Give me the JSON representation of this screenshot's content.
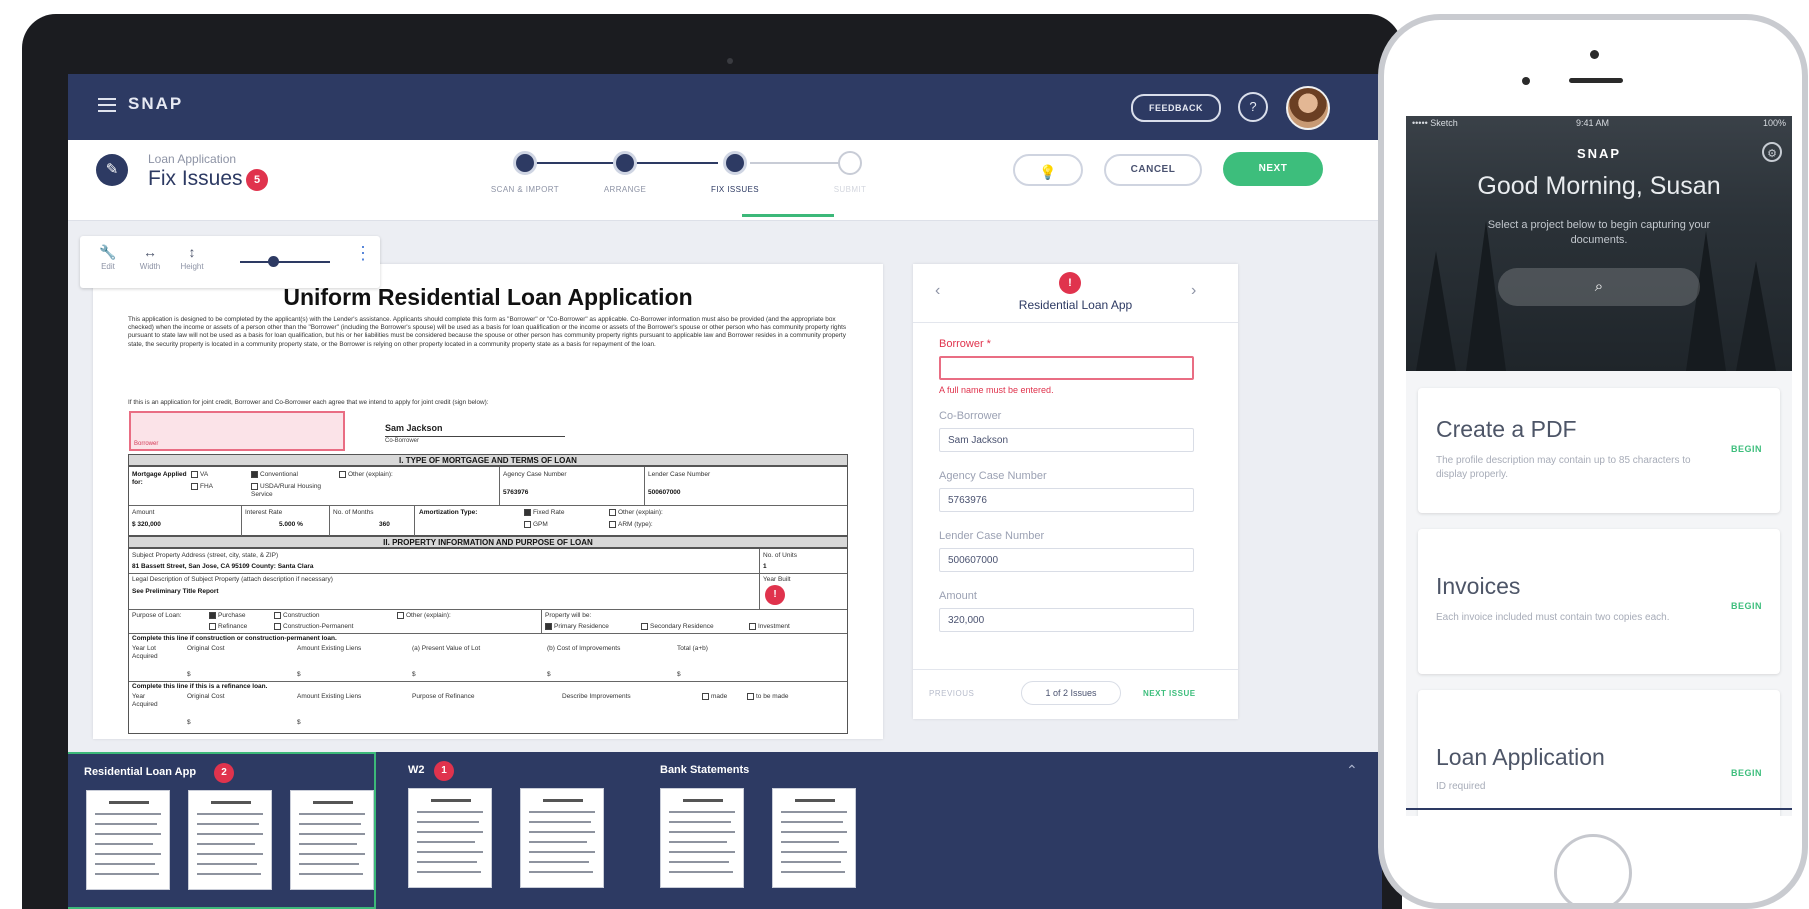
{
  "app": {
    "brand": "SNAP",
    "feedback_label": "FEEDBACK",
    "help_glyph": "?"
  },
  "header": {
    "kicker": "Loan Application",
    "title": "Fix Issues",
    "issue_badge": "5",
    "cancel_label": "CANCEL",
    "next_label": "NEXT"
  },
  "stepper": {
    "steps": [
      {
        "label": "SCAN & IMPORT",
        "state": "done"
      },
      {
        "label": "ARRANGE",
        "state": "done"
      },
      {
        "label": "FIX ISSUES",
        "state": "active"
      },
      {
        "label": "SUBMIT",
        "state": "future"
      }
    ]
  },
  "toolbar": {
    "tools": [
      {
        "icon": "wrench-icon",
        "glyph": "🔧",
        "label": "Edit"
      },
      {
        "icon": "width-icon",
        "glyph": "↔",
        "label": "Width"
      },
      {
        "icon": "height-icon",
        "glyph": "↕",
        "label": "Height"
      }
    ],
    "zoom_level": 0.3
  },
  "document": {
    "heading": "Uniform Residential Loan Application",
    "intro": "This application is designed to be completed by the applicant(s) with the Lender's assistance. Applicants should complete this form as \"Borrower\" or \"Co-Borrower\" as applicable. Co-Borrower information must also be provided (and the appropriate box checked) when the income or assets of a person other than the \"Borrower\" (including the Borrower's spouse) will be used as a basis for loan qualification or the income or assets of the Borrower's spouse or other person who has community property rights pursuant to state law will not be used as a basis for loan qualification, but his or her liabilities must be considered because the spouse or other person has community property rights pursuant to applicable law and Borrower resides in a community property state, the security property is located in a community property state, or the Borrower is relying on other property located in a community property state as a basis for repayment of the loan.",
    "joint_credit_line": "If this is an application for joint credit, Borrower and Co-Borrower each agree that we intend to apply for joint credit (sign below):",
    "borrower_caption": "Borrower",
    "coborrower_name": "Sam Jackson",
    "coborrower_caption": "Co-Borrower",
    "section1": "I. TYPE OF MORTGAGE AND TERMS OF LOAN",
    "section2": "II. PROPERTY INFORMATION AND PURPOSE OF LOAN",
    "mortgage_applied_for": "Mortgage Applied for:",
    "opt_va": "VA",
    "opt_fha": "FHA",
    "opt_conventional": "Conventional",
    "opt_usda": "USDA/Rural Housing Service",
    "opt_other": "Other (explain):",
    "agency_case_label": "Agency Case Number",
    "agency_case_value": "5763976",
    "lender_case_label": "Lender Case Number",
    "lender_case_value": "500607000",
    "amount_label": "Amount",
    "amount_value": "$ 320,000",
    "interest_label": "Interest Rate",
    "interest_value": "5.000 %",
    "months_label": "No. of Months",
    "months_value": "360",
    "amort_label": "Amortization Type:",
    "amort_fixed": "Fixed Rate",
    "amort_gpm": "GPM",
    "amort_other": "Other (explain):",
    "amort_arm": "ARM (type):",
    "subject_address_label": "Subject Property Address (street, city, state, & ZIP)",
    "subject_address_value": "81 Bassett Street, San Jose, CA 95109  County: Santa Clara",
    "units_label": "No. of Units",
    "units_value": "1",
    "legal_desc_label": "Legal Description of Subject Property (attach description if necessary)",
    "legal_desc_value": "See Preliminary Title Report",
    "year_built_label": "Year Built",
    "purpose_label": "Purpose of Loan:",
    "purpose_purchase": "Purchase",
    "purpose_refinance": "Refinance",
    "purpose_construction": "Construction",
    "purpose_construction_perm": "Construction-Permanent",
    "purpose_other": "Other (explain):",
    "property_will_be": "Property will be:",
    "prop_primary": "Primary Residence",
    "prop_secondary": "Secondary Residence",
    "prop_investment": "Investment",
    "construction_line": "Complete this line if construction or construction-permanent loan.",
    "col_year_lot": "Year Lot Acquired",
    "col_original_cost": "Original Cost",
    "col_existing_liens": "Amount Existing Liens",
    "col_present_value": "(a) Present Value of Lot",
    "col_improvements": "(b) Cost of Improvements",
    "col_total": "Total (a+b)",
    "dollar": "$",
    "refinance_line": "Complete this line if this is a refinance loan.",
    "col_year_acquired": "Year Acquired",
    "col_purpose_refi": "Purpose of Refinance",
    "col_describe_improvements": "Describe Improvements",
    "made": "made",
    "to_be_made": "to be made",
    "issue_marker": "!"
  },
  "issues_panel": {
    "badge": "!",
    "title": "Residential Loan App",
    "fields": [
      {
        "label": "Borrower *",
        "value": "",
        "error": true
      },
      {
        "label": "Co-Borrower",
        "value": "Sam Jackson",
        "error": false
      },
      {
        "label": "Agency Case Number",
        "value": "5763976",
        "error": false
      },
      {
        "label": "Lender Case Number",
        "value": "500607000",
        "error": false
      },
      {
        "label": "Amount",
        "value": "320,000",
        "error": false
      }
    ],
    "error_message": "A full name must be entered.",
    "previous_label": "PREVIOUS",
    "count_label": "1 of 2 Issues",
    "next_issue_label": "NEXT ISSUE"
  },
  "tray": {
    "groups": [
      {
        "label": "Residential Loan App",
        "badge": "2",
        "thumbs": 3
      },
      {
        "label": "W2",
        "badge": "1",
        "thumbs": 2
      },
      {
        "label": "Bank Statements",
        "badge": "",
        "thumbs": 2
      }
    ]
  },
  "phone": {
    "status_left": "••••• Sketch",
    "status_time": "9:41 AM",
    "status_right": "100%",
    "brand": "SNAP",
    "greeting": "Good Morning, Susan",
    "subtitle": "Select a project below to begin capturing your documents.",
    "cards": [
      {
        "title": "Create a PDF",
        "desc": "The profile description may contain up to 85 characters to display properly.",
        "action": "BEGIN"
      },
      {
        "title": "Invoices",
        "desc": "Each invoice included must contain two copies each.",
        "action": "BEGIN"
      },
      {
        "title": "Loan Application",
        "desc": "ID required",
        "action": "BEGIN"
      }
    ]
  },
  "colors": {
    "navy": "#2d3a63",
    "green": "#3dbe7c",
    "error_red": "#e0334d"
  }
}
